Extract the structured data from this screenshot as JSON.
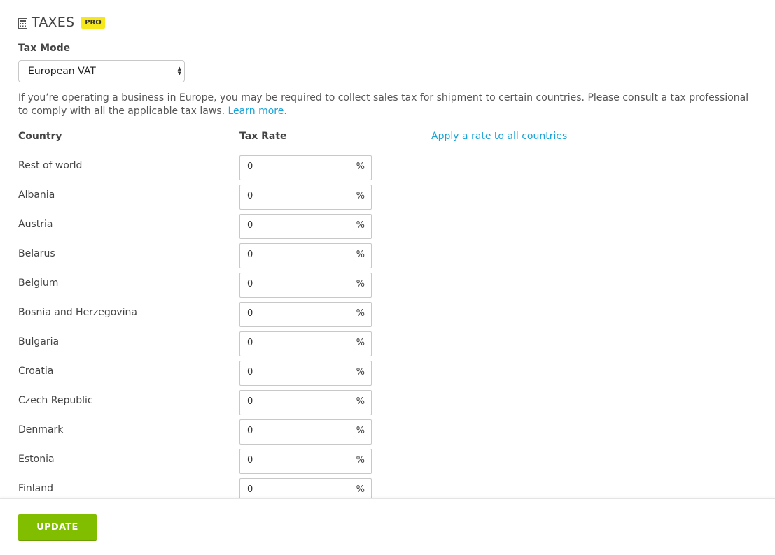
{
  "header": {
    "title": "TAXES",
    "badge": "PRO",
    "icon": "calculator-icon"
  },
  "tax_mode": {
    "label": "Tax Mode",
    "selected": "European VAT"
  },
  "description": {
    "text": "If you’re operating a business in Europe, you may be required to collect sales tax for shipment to certain countries. Please consult a tax professional to comply with all the applicable tax laws.",
    "link": "Learn more."
  },
  "table": {
    "country_header": "Country",
    "rate_header": "Tax Rate",
    "apply_all_link": "Apply a rate to all countries",
    "percent_symbol": "%",
    "rows": [
      {
        "country": "Rest of world",
        "rate": "0"
      },
      {
        "country": "Albania",
        "rate": "0"
      },
      {
        "country": "Austria",
        "rate": "0"
      },
      {
        "country": "Belarus",
        "rate": "0"
      },
      {
        "country": "Belgium",
        "rate": "0"
      },
      {
        "country": "Bosnia and Herzegovina",
        "rate": "0"
      },
      {
        "country": "Bulgaria",
        "rate": "0"
      },
      {
        "country": "Croatia",
        "rate": "0"
      },
      {
        "country": "Czech Republic",
        "rate": "0"
      },
      {
        "country": "Denmark",
        "rate": "0"
      },
      {
        "country": "Estonia",
        "rate": "0"
      },
      {
        "country": "Finland",
        "rate": "0"
      }
    ]
  },
  "footer": {
    "update_label": "UPDATE"
  },
  "colors": {
    "accent_link": "#19a3d6",
    "button_green": "#82be00",
    "badge_yellow": "#f5e71c"
  }
}
